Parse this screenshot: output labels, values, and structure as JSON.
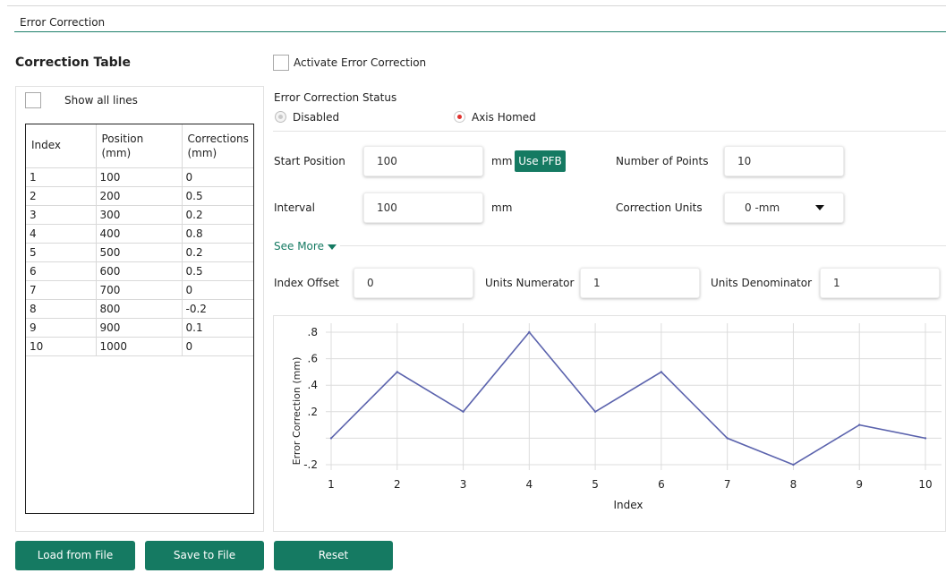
{
  "header": {
    "title": "Error Correction"
  },
  "table_section": {
    "title": "Correction Table",
    "show_all_label": "Show all lines",
    "show_all_checked": false,
    "columns": [
      {
        "line1": "Index",
        "line2": ""
      },
      {
        "line1": "Position",
        "line2": "(mm)"
      },
      {
        "line1": "Corrections",
        "line2": "(mm)"
      }
    ],
    "rows": [
      [
        "1",
        "100",
        "0"
      ],
      [
        "2",
        "200",
        "0.5"
      ],
      [
        "3",
        "300",
        "0.2"
      ],
      [
        "4",
        "400",
        "0.8"
      ],
      [
        "5",
        "500",
        "0.2"
      ],
      [
        "6",
        "600",
        "0.5"
      ],
      [
        "7",
        "700",
        "0"
      ],
      [
        "8",
        "800",
        "-0.2"
      ],
      [
        "9",
        "900",
        "0.1"
      ],
      [
        "10",
        "1000",
        "0"
      ]
    ]
  },
  "settings": {
    "activate_label": "Activate Error Correction",
    "activate_checked": false,
    "status_label": "Error Correction Status",
    "status_options": {
      "disabled": "Disabled",
      "homed": "Axis Homed"
    },
    "status_selected": "homed",
    "start_position": {
      "label": "Start Position",
      "value": "100",
      "unit": "mm"
    },
    "use_pfb_label": "Use PFB",
    "number_of_points": {
      "label": "Number of Points",
      "value": "10"
    },
    "interval": {
      "label": "Interval",
      "value": "100",
      "unit": "mm"
    },
    "correction_units": {
      "label": "Correction Units",
      "value": "0 -mm"
    },
    "see_more_label": "See More",
    "index_offset": {
      "label": "Index Offset",
      "value": "0"
    },
    "units_numerator": {
      "label": "Units Numerator",
      "value": "1"
    },
    "units_denominator": {
      "label": "Units Denominator",
      "value": "1"
    }
  },
  "buttons": {
    "load": "Load from File",
    "save": "Save to File",
    "reset": "Reset"
  },
  "colors": {
    "accent": "#157a62",
    "chart_line": "#5b63ad",
    "radio_selected": "#e0322e"
  },
  "chart_data": {
    "type": "line",
    "xlabel": "Index",
    "ylabel": "Error Correction (mm)",
    "x": [
      1,
      2,
      3,
      4,
      5,
      6,
      7,
      8,
      9,
      10
    ],
    "series": [
      {
        "values": [
          0,
          0.5,
          0.2,
          0.8,
          0.2,
          0.5,
          0,
          -0.2,
          0.1,
          0
        ]
      }
    ],
    "x_ticks": [
      "1",
      "2",
      "3",
      "4",
      "5",
      "6",
      "7",
      "8",
      "9",
      "10"
    ],
    "y_ticks": [
      {
        "value": -0.2,
        "label": "-.2"
      },
      {
        "value": 0.2,
        "label": ".2"
      },
      {
        "value": 0.4,
        "label": ".4"
      },
      {
        "value": 0.6,
        "label": ".6"
      },
      {
        "value": 0.8,
        "label": ".8"
      }
    ],
    "xlim": [
      1,
      10
    ],
    "ylim": [
      -0.2,
      0.8
    ],
    "grid": true
  }
}
